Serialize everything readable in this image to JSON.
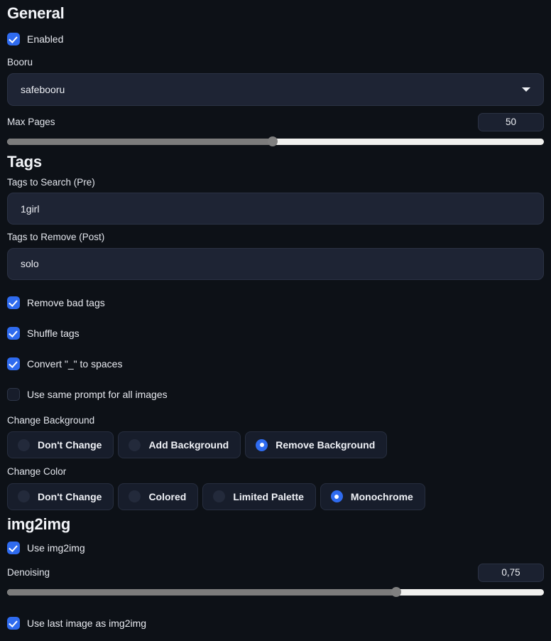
{
  "theme": {
    "background": "#0d1117",
    "accent": "#2f6bef",
    "input_bg": "#1e2434",
    "pill_bg": "#171d2b",
    "text": "#e8eaf0",
    "slider_fill": "#7c7c7c",
    "slider_track": "#f0f0ee"
  },
  "general": {
    "title": "General",
    "enabled": {
      "label": "Enabled",
      "checked": true
    },
    "booru": {
      "label": "Booru",
      "value": "safebooru",
      "caret_icon": "chevron-down-icon"
    },
    "max_pages": {
      "label": "Max Pages",
      "value": "50",
      "percent": 49.5
    }
  },
  "tags": {
    "title": "Tags",
    "tags_to_search": {
      "label": "Tags to Search (Pre)",
      "value": "1girl"
    },
    "tags_to_remove": {
      "label": "Tags to Remove (Post)",
      "value": "solo"
    },
    "checkboxes": [
      {
        "label": "Remove bad tags",
        "checked": true
      },
      {
        "label": "Shuffle tags",
        "checked": true
      },
      {
        "label": "Convert \"_\" to spaces",
        "checked": true
      },
      {
        "label": "Use same prompt for all images",
        "checked": false
      }
    ],
    "change_background": {
      "label": "Change Background",
      "options": [
        {
          "label": "Don't Change",
          "selected": false
        },
        {
          "label": "Add Background",
          "selected": false
        },
        {
          "label": "Remove Background",
          "selected": true
        }
      ]
    },
    "change_color": {
      "label": "Change Color",
      "options": [
        {
          "label": "Don't Change",
          "selected": false
        },
        {
          "label": "Colored",
          "selected": false
        },
        {
          "label": "Limited Palette",
          "selected": false
        },
        {
          "label": "Monochrome",
          "selected": true
        }
      ]
    }
  },
  "img2img": {
    "title": "img2img",
    "use_img2img": {
      "label": "Use img2img",
      "checked": true
    },
    "denoising": {
      "label": "Denoising",
      "value": "0,75",
      "percent": 72.5
    },
    "use_last_image": {
      "label": "Use last image as img2img",
      "checked": true
    }
  }
}
